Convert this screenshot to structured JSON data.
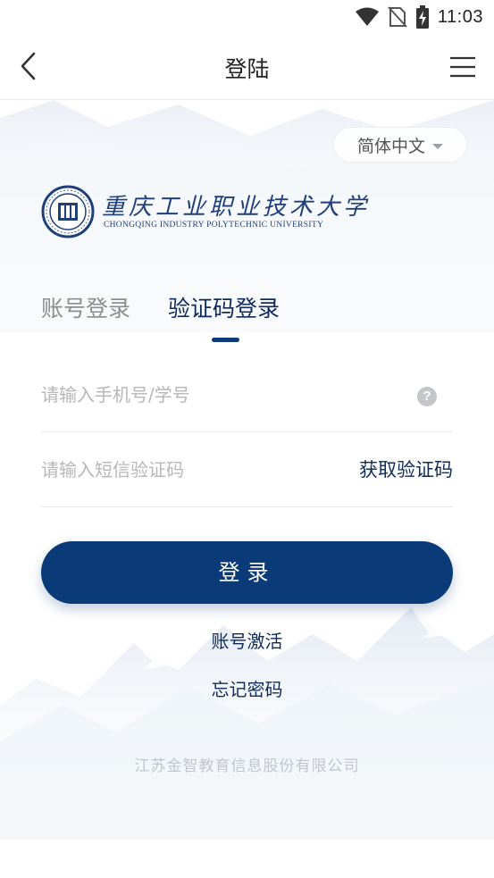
{
  "status_bar": {
    "time": "11:03"
  },
  "nav": {
    "title": "登陆"
  },
  "language": {
    "selected": "简体中文"
  },
  "logo": {
    "name_cn": "重庆工业职业技术大学",
    "name_en": "CHONGQING INDUSTRY POLYTECHNIC UNIVERSITY"
  },
  "tabs": [
    {
      "label": "账号登录",
      "active": false
    },
    {
      "label": "验证码登录",
      "active": true
    }
  ],
  "form": {
    "phone_placeholder": "请输入手机号/学号",
    "code_placeholder": "请输入短信验证码",
    "get_code_label": "获取验证码",
    "help_symbol": "?"
  },
  "login_button": {
    "label": "登录"
  },
  "links": {
    "activate": "账号激活",
    "forgot": "忘记密码"
  },
  "footer": "江苏金智教育信息股份有限公司",
  "colors": {
    "primary": "#0b3a78",
    "text_dark": "#0f2a5c",
    "muted": "#8d8d8d"
  }
}
